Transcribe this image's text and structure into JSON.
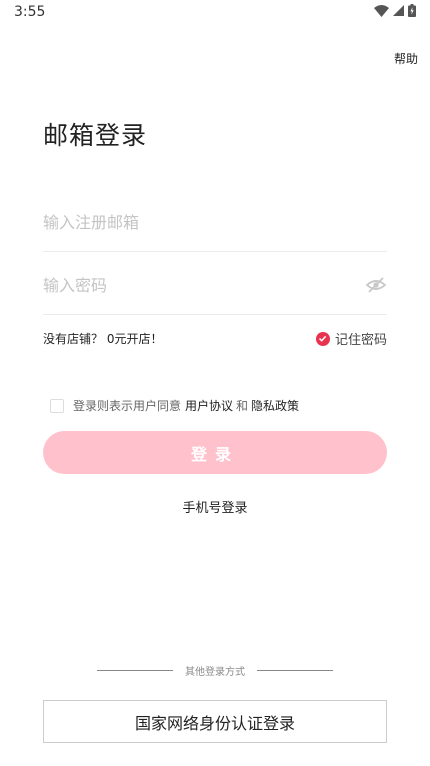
{
  "status_bar": {
    "time": "3:55"
  },
  "header": {
    "help_label": "帮助"
  },
  "page_title": "邮箱登录",
  "form": {
    "email_placeholder": "输入注册邮箱",
    "password_placeholder": "输入密码",
    "no_shop_text": "没有店铺？ 0元开店！",
    "remember_label": "记住密码"
  },
  "agreement": {
    "prefix": "登录则表示用户同意",
    "user_agreement": "用户协议",
    "and": "和",
    "privacy_policy": "隐私政策"
  },
  "login_button_label": "登录",
  "phone_login_label": "手机号登录",
  "other_methods_label": "其他登录方式",
  "national_id_login_label": "国家网络身份认证登录",
  "colors": {
    "accent": "#e8334f",
    "login_button_bg": "#ffc1cb"
  }
}
